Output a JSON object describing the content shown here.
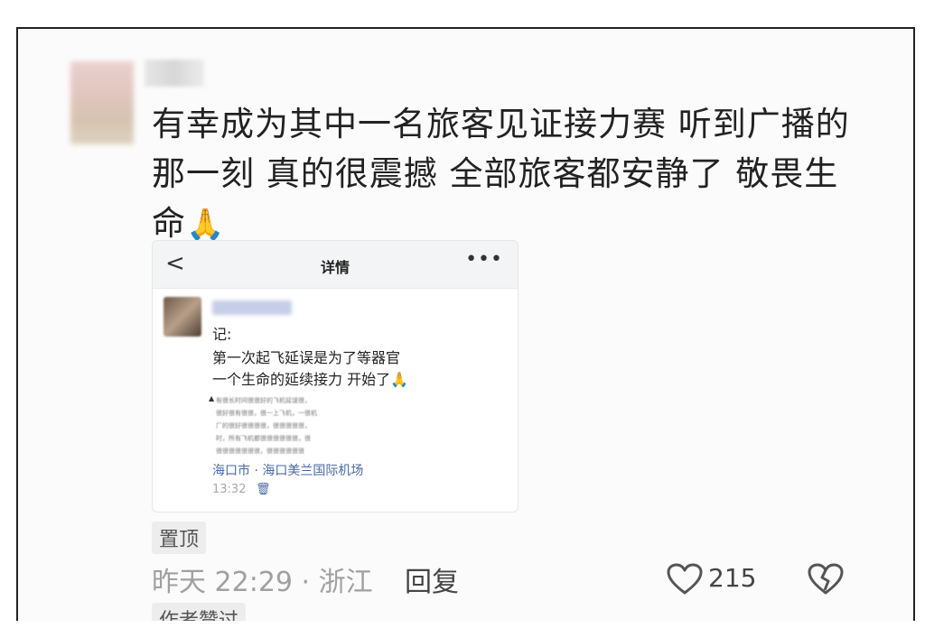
{
  "comment": {
    "text_line1": "有幸成为其中一名旅客见证接力赛 听到广播的",
    "text_line2": "那一刻 真的很震撼  全部旅客都安静了  敬畏生",
    "text_line3": "命",
    "emoji": "🙏"
  },
  "card": {
    "title": "详情",
    "back_icon": "<",
    "more_icon": "•••",
    "line1": "记:",
    "line2": "第一次起飞延误是为了等器官",
    "line3": "一个生命的延续接力 开始了🙏",
    "blurred_lines": [
      "有很长时间很很好的飞机延误很，",
      "很好很有很很，很一上飞机，一很机",
      "厂的很好很很很很，很很很很很，",
      "时，所有飞机都很很很很很很，很",
      "很很很很很很很，很很很很很很"
    ],
    "location": "海口市 · 海口美兰国际机场",
    "time": "13:32"
  },
  "footer": {
    "pin_label": "置顶",
    "meta": "昨天 22:29 · 浙江",
    "reply_label": "回复",
    "like_count": "215",
    "author_badge": "作者赞过"
  }
}
